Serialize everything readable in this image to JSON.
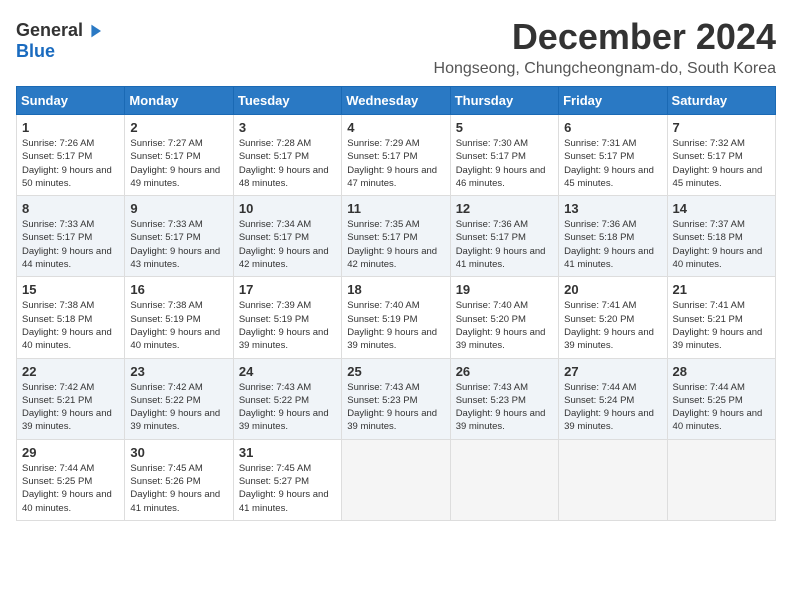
{
  "logo": {
    "general": "General",
    "blue": "Blue"
  },
  "title": "December 2024",
  "location": "Hongseong, Chungcheongnam-do, South Korea",
  "days_of_week": [
    "Sunday",
    "Monday",
    "Tuesday",
    "Wednesday",
    "Thursday",
    "Friday",
    "Saturday"
  ],
  "weeks": [
    [
      {
        "day": "1",
        "sunrise": "7:26 AM",
        "sunset": "5:17 PM",
        "daylight": "9 hours and 50 minutes."
      },
      {
        "day": "2",
        "sunrise": "7:27 AM",
        "sunset": "5:17 PM",
        "daylight": "9 hours and 49 minutes."
      },
      {
        "day": "3",
        "sunrise": "7:28 AM",
        "sunset": "5:17 PM",
        "daylight": "9 hours and 48 minutes."
      },
      {
        "day": "4",
        "sunrise": "7:29 AM",
        "sunset": "5:17 PM",
        "daylight": "9 hours and 47 minutes."
      },
      {
        "day": "5",
        "sunrise": "7:30 AM",
        "sunset": "5:17 PM",
        "daylight": "9 hours and 46 minutes."
      },
      {
        "day": "6",
        "sunrise": "7:31 AM",
        "sunset": "5:17 PM",
        "daylight": "9 hours and 45 minutes."
      },
      {
        "day": "7",
        "sunrise": "7:32 AM",
        "sunset": "5:17 PM",
        "daylight": "9 hours and 45 minutes."
      }
    ],
    [
      {
        "day": "8",
        "sunrise": "7:33 AM",
        "sunset": "5:17 PM",
        "daylight": "9 hours and 44 minutes."
      },
      {
        "day": "9",
        "sunrise": "7:33 AM",
        "sunset": "5:17 PM",
        "daylight": "9 hours and 43 minutes."
      },
      {
        "day": "10",
        "sunrise": "7:34 AM",
        "sunset": "5:17 PM",
        "daylight": "9 hours and 42 minutes."
      },
      {
        "day": "11",
        "sunrise": "7:35 AM",
        "sunset": "5:17 PM",
        "daylight": "9 hours and 42 minutes."
      },
      {
        "day": "12",
        "sunrise": "7:36 AM",
        "sunset": "5:17 PM",
        "daylight": "9 hours and 41 minutes."
      },
      {
        "day": "13",
        "sunrise": "7:36 AM",
        "sunset": "5:18 PM",
        "daylight": "9 hours and 41 minutes."
      },
      {
        "day": "14",
        "sunrise": "7:37 AM",
        "sunset": "5:18 PM",
        "daylight": "9 hours and 40 minutes."
      }
    ],
    [
      {
        "day": "15",
        "sunrise": "7:38 AM",
        "sunset": "5:18 PM",
        "daylight": "9 hours and 40 minutes."
      },
      {
        "day": "16",
        "sunrise": "7:38 AM",
        "sunset": "5:19 PM",
        "daylight": "9 hours and 40 minutes."
      },
      {
        "day": "17",
        "sunrise": "7:39 AM",
        "sunset": "5:19 PM",
        "daylight": "9 hours and 39 minutes."
      },
      {
        "day": "18",
        "sunrise": "7:40 AM",
        "sunset": "5:19 PM",
        "daylight": "9 hours and 39 minutes."
      },
      {
        "day": "19",
        "sunrise": "7:40 AM",
        "sunset": "5:20 PM",
        "daylight": "9 hours and 39 minutes."
      },
      {
        "day": "20",
        "sunrise": "7:41 AM",
        "sunset": "5:20 PM",
        "daylight": "9 hours and 39 minutes."
      },
      {
        "day": "21",
        "sunrise": "7:41 AM",
        "sunset": "5:21 PM",
        "daylight": "9 hours and 39 minutes."
      }
    ],
    [
      {
        "day": "22",
        "sunrise": "7:42 AM",
        "sunset": "5:21 PM",
        "daylight": "9 hours and 39 minutes."
      },
      {
        "day": "23",
        "sunrise": "7:42 AM",
        "sunset": "5:22 PM",
        "daylight": "9 hours and 39 minutes."
      },
      {
        "day": "24",
        "sunrise": "7:43 AM",
        "sunset": "5:22 PM",
        "daylight": "9 hours and 39 minutes."
      },
      {
        "day": "25",
        "sunrise": "7:43 AM",
        "sunset": "5:23 PM",
        "daylight": "9 hours and 39 minutes."
      },
      {
        "day": "26",
        "sunrise": "7:43 AM",
        "sunset": "5:23 PM",
        "daylight": "9 hours and 39 minutes."
      },
      {
        "day": "27",
        "sunrise": "7:44 AM",
        "sunset": "5:24 PM",
        "daylight": "9 hours and 39 minutes."
      },
      {
        "day": "28",
        "sunrise": "7:44 AM",
        "sunset": "5:25 PM",
        "daylight": "9 hours and 40 minutes."
      }
    ],
    [
      {
        "day": "29",
        "sunrise": "7:44 AM",
        "sunset": "5:25 PM",
        "daylight": "9 hours and 40 minutes."
      },
      {
        "day": "30",
        "sunrise": "7:45 AM",
        "sunset": "5:26 PM",
        "daylight": "9 hours and 41 minutes."
      },
      {
        "day": "31",
        "sunrise": "7:45 AM",
        "sunset": "5:27 PM",
        "daylight": "9 hours and 41 minutes."
      },
      null,
      null,
      null,
      null
    ]
  ]
}
